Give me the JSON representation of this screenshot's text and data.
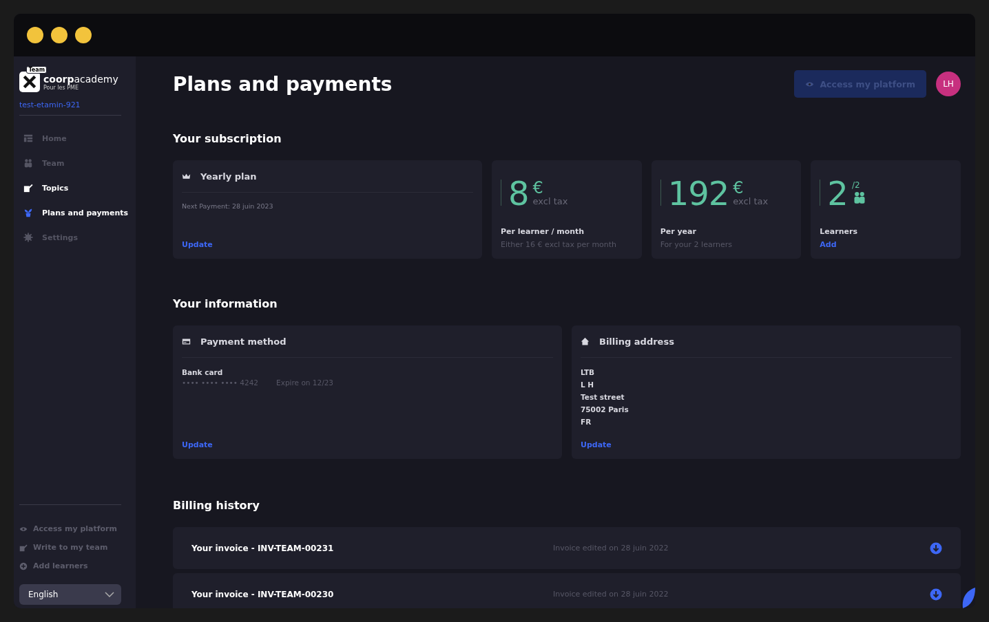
{
  "sidebar": {
    "brand": "coorp",
    "brand_rest": "academy",
    "badge": "Team",
    "tagline": "Pour les PME",
    "workspace": "test-etamin-921",
    "items": [
      {
        "label": "Home",
        "disabled": true,
        "selected": false
      },
      {
        "label": "Team",
        "disabled": true,
        "selected": false
      },
      {
        "label": "Topics",
        "disabled": false,
        "selected": false
      },
      {
        "label": "Plans and payments",
        "disabled": false,
        "selected": true
      },
      {
        "label": "Settings",
        "disabled": true,
        "selected": false
      }
    ],
    "links": [
      {
        "label": "Access my platform"
      },
      {
        "label": "Write to my team"
      },
      {
        "label": "Add learners"
      }
    ],
    "language": "English"
  },
  "header": {
    "title": "Plans and payments",
    "button": "Access my platform",
    "avatar": "LH"
  },
  "subscription": {
    "heading": "Your subscription",
    "plan": {
      "title": "Yearly plan",
      "next": "Next Payment: 28 juin 2023",
      "action": "Update"
    },
    "stats": [
      {
        "kind": "price",
        "value": "8",
        "unit": "€",
        "note": "excl tax",
        "label": "Per learner / month",
        "sub": "Either 16 € excl tax per month"
      },
      {
        "kind": "price",
        "value": "192",
        "unit": "€",
        "note": "excl tax",
        "label": "Per year",
        "sub": "For your 2 learners"
      },
      {
        "kind": "count",
        "value": "2",
        "unit": "/2",
        "label": "Learners",
        "action": "Add"
      }
    ]
  },
  "information": {
    "heading": "Your information",
    "payment": {
      "title": "Payment method",
      "type": "Bank card",
      "number": "•••• •••• •••• 4242",
      "expiry": "Expire on 12/23",
      "action": "Update"
    },
    "address": {
      "title": "Billing address",
      "lines": [
        "LTB",
        "L H",
        "Test street",
        "75002 Paris",
        "FR"
      ],
      "action": "Update"
    }
  },
  "billing": {
    "heading": "Billing history",
    "invoices": [
      {
        "title": "Your invoice - INV-TEAM-00231",
        "date": "Invoice edited on 28 juin 2022"
      },
      {
        "title": "Your invoice - INV-TEAM-00230",
        "date": "Invoice edited on 28 juin 2022"
      }
    ]
  }
}
